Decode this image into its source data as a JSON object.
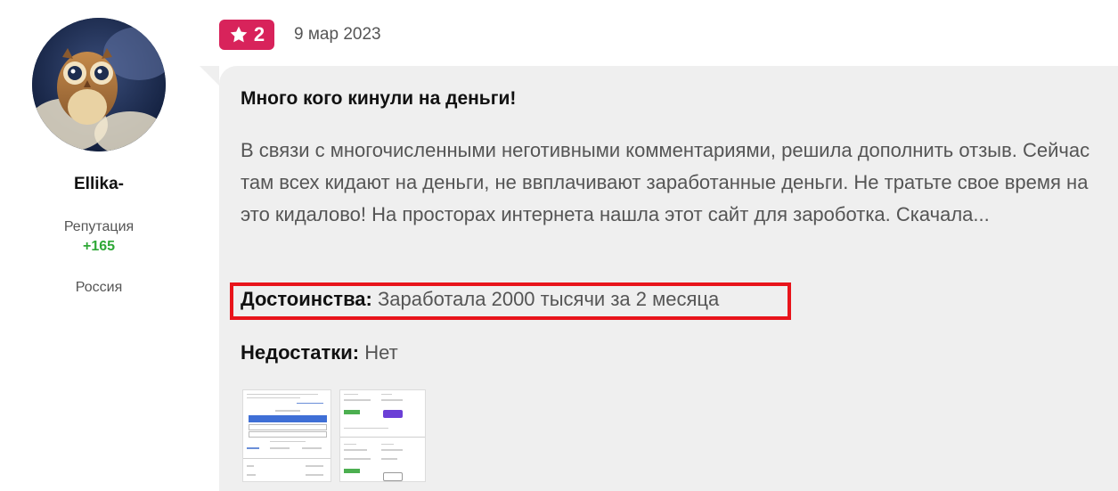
{
  "author": {
    "name": "Ellika-",
    "reputation_label": "Репутация",
    "reputation_value": "+165",
    "location": "Россия"
  },
  "review": {
    "rating": "2",
    "rating_icon": "star-icon",
    "date": "9 мар 2023",
    "title": "Много кого кинули на деньги!",
    "body": "В связи с многочисленными неготивными комментариями, решила дополнить отзыв. Сейчас там всех кидают на деньги, не ввплачивают заработанные деньги. Не тратьте свое время на это кидалово! На просторах интернета нашла этот сайт для зароботка. Скачала...",
    "pros_label": "Достоинства:",
    "pros_text": "Заработала 2000 тысячи за 2 месяца",
    "cons_label": "Недостатки:",
    "cons_text": "Нет"
  },
  "colors": {
    "rating_badge": "#d8235b",
    "reputation_positive": "#2ea836",
    "highlight_box": "#e8141b",
    "card_background": "#efefef"
  }
}
